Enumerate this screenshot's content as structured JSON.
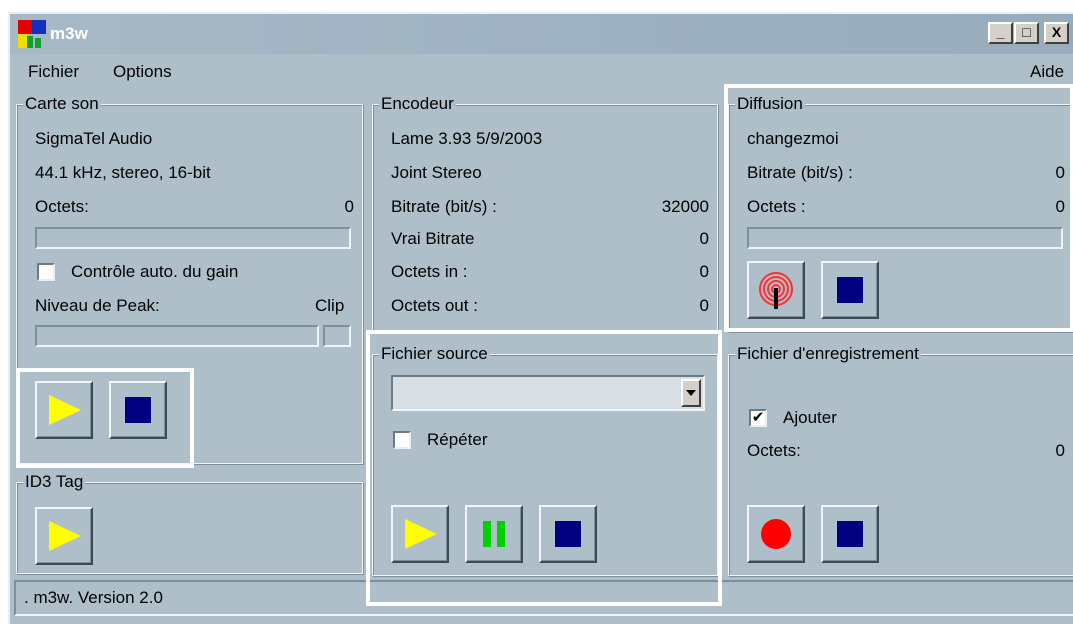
{
  "window": {
    "title": "m3w",
    "min_glyph": "_",
    "max_glyph": "□",
    "close_glyph": "X"
  },
  "menu": {
    "file": "Fichier",
    "options": "Options",
    "help": "Aide"
  },
  "soundcard": {
    "legend": "Carte son",
    "device": "SigmaTel Audio",
    "format": "44.1 kHz, stereo, 16-bit",
    "bytes_label": "Octets:",
    "bytes_value": "0",
    "agc_label": "Contrôle auto. du gain",
    "agc_checked": false,
    "peak_label": "Niveau de Peak:",
    "clip_label": "Clip"
  },
  "encoder": {
    "legend": "Encodeur",
    "version": "Lame 3.93 5/9/2003",
    "mode": "Joint Stereo",
    "bitrate_label": "Bitrate (bit/s) :",
    "bitrate_value": "32000",
    "real_bitrate_label": "Vrai Bitrate",
    "real_bitrate_value": "0",
    "bytes_in_label": "Octets in :",
    "bytes_in_value": "0",
    "bytes_out_label": "Octets out :",
    "bytes_out_value": "0"
  },
  "broadcast": {
    "legend": "Diffusion",
    "name": "changezmoi",
    "bitrate_label": "Bitrate (bit/s) :",
    "bitrate_value": "0",
    "bytes_label": "Octets :",
    "bytes_value": "0"
  },
  "source_file": {
    "legend": "Fichier source",
    "selected": "",
    "repeat_label": "Répéter",
    "repeat_checked": false
  },
  "record_file": {
    "legend": "Fichier d'enregistrement",
    "append_label": "Ajouter",
    "append_checked": true,
    "append_mark": "✔",
    "bytes_label": "Octets:",
    "bytes_value": "0"
  },
  "id3": {
    "legend": "ID3 Tag"
  },
  "status": {
    "text": ".  m3w.  Version 2.0"
  },
  "colors": {
    "window_bg": "#aebfca",
    "play_yellow": "#ffff00",
    "stop_navy": "#000080",
    "pause_green": "#00d000",
    "record_red": "#ff0000",
    "antenna_red": "#ff3030",
    "highlight": "#ffffff"
  }
}
